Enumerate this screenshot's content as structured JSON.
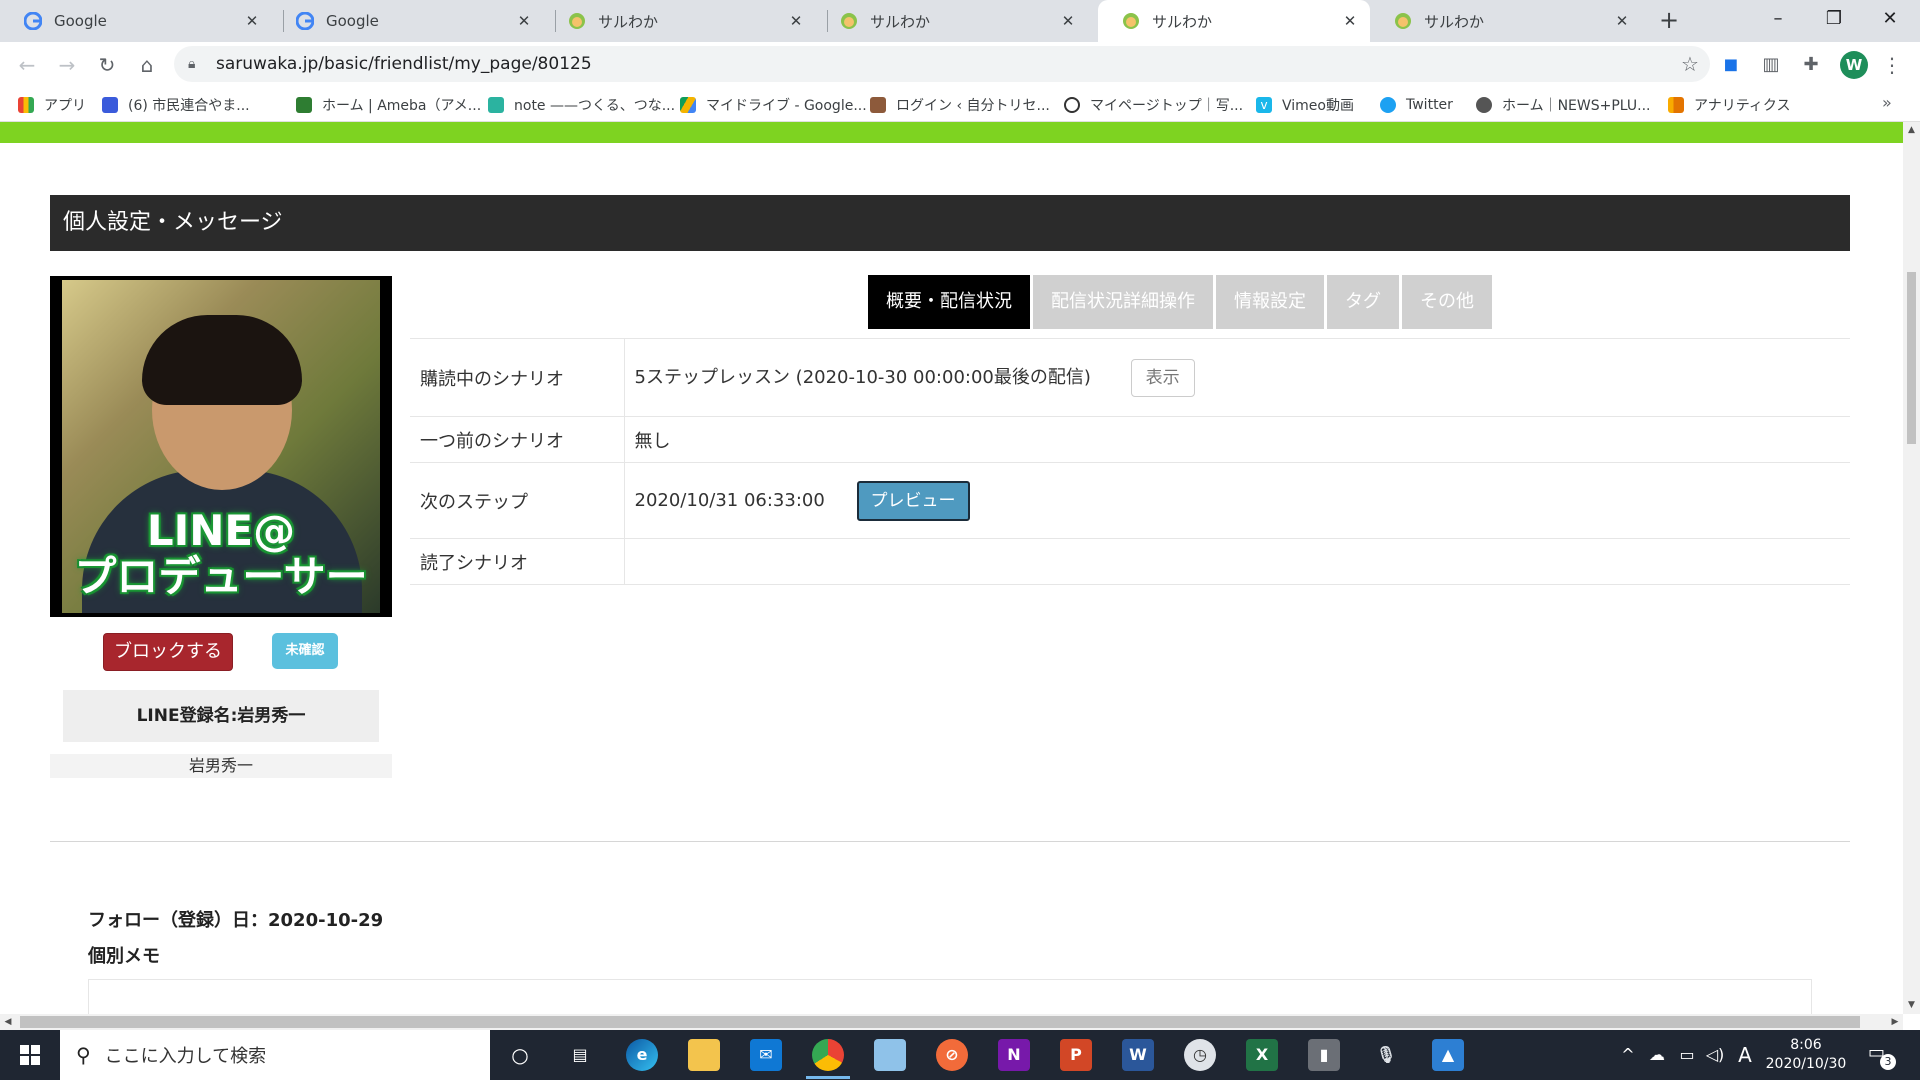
{
  "browser": {
    "tabs": [
      {
        "title": "Google",
        "icon": "google-icon",
        "active": false
      },
      {
        "title": "Google",
        "icon": "google-icon",
        "active": false
      },
      {
        "title": "サルわか",
        "icon": "saruwaka-icon",
        "active": false
      },
      {
        "title": "サルわか",
        "icon": "saruwaka-icon",
        "active": false
      },
      {
        "title": "サルわか",
        "icon": "saruwaka-icon",
        "active": true
      },
      {
        "title": "サルわか",
        "icon": "saruwaka-icon",
        "active": false
      }
    ],
    "url": "saruwaka.jp/basic/friendlist/my_page/80125",
    "profile_initial": "W",
    "bookmarks": [
      {
        "label": "アプリ",
        "color": "#ea4335"
      },
      {
        "label": "(6) 市民連合やま...",
        "color": "#3b5bdb"
      },
      {
        "label": "ホーム | Ameba（アメ...",
        "color": "#2e7d32"
      },
      {
        "label": "note ——つくる、つな...",
        "color": "#2bb3a0"
      },
      {
        "label": "マイドライブ - Google...",
        "color": "#f4b400"
      },
      {
        "label": "ログイン ‹ 自分トリセ...",
        "color": "#8d5a3b"
      },
      {
        "label": "マイページトップ｜写...",
        "color": "#333333"
      },
      {
        "label": "Vimeo動画",
        "color": "#1ab7ea"
      },
      {
        "label": "Twitter",
        "color": "#1da1f2"
      },
      {
        "label": "ホーム｜NEWS+PLU...",
        "color": "#555555"
      },
      {
        "label": "アナリティクス",
        "color": "#f57c00"
      }
    ]
  },
  "page": {
    "header_title": "個人設定・メッセージ",
    "photo_text_line1": "LINE@",
    "photo_text_line2": "プロデューサー",
    "block_button": "ブロックする",
    "unconfirmed_badge": "未確認",
    "line_name": "LINE登録名:岩男秀一",
    "real_name": "岩男秀一",
    "tabs": [
      {
        "label": "概要・配信状況",
        "active": true
      },
      {
        "label": "配信状況詳細操作",
        "active": false
      },
      {
        "label": "情報設定",
        "active": false
      },
      {
        "label": "タグ",
        "active": false
      },
      {
        "label": "その他",
        "active": false
      }
    ],
    "table": {
      "row1_label": "購読中のシナリオ",
      "row1_value": "5ステップレッスン (2020-10-30 00:00:00最後の配信)",
      "row1_button": "表示",
      "row2_label": "一つ前のシナリオ",
      "row2_value": "無し",
      "row3_label": "次のステップ",
      "row3_value": "2020/10/31 06:33:00",
      "row3_button": "プレビュー",
      "row4_label": "読了シナリオ",
      "row4_value": ""
    },
    "follow_date": "フォロー（登録）日：2020-10-29",
    "memo_label": "個別メモ"
  },
  "taskbar": {
    "search_placeholder": "ここに入力して検索",
    "time": "8:06",
    "date": "2020/10/30",
    "ime": "A",
    "notification_count": "3"
  }
}
